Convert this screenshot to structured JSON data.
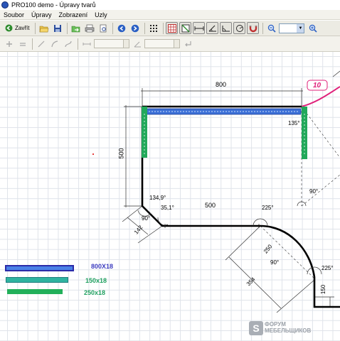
{
  "window": {
    "title": "PRO100 demo - Úpravy tvarů"
  },
  "menu": [
    "Soubor",
    "Úpravy",
    "Zobrazení",
    "Uzly"
  ],
  "toolbar": {
    "close_label": "Zavřít"
  },
  "drawing": {
    "dim_top": "800",
    "dim_left": "500",
    "dim_mid": "500",
    "dim_142": "142",
    "dim_250": "250",
    "dim_354": "354",
    "dim_150": "150",
    "angle_135": "135°",
    "angle_134_9": "134,9°",
    "angle_35_1": "35,1°",
    "angle_90_a": "90°",
    "angle_90_b": "90°",
    "angle_90_c": "90°",
    "angle_225_a": "225°",
    "angle_225_b": "225°",
    "tag_10": "10"
  },
  "legend": [
    {
      "label": "800X18",
      "color": "#3c3cbf"
    },
    {
      "label": "150x18",
      "color": "#20a060"
    },
    {
      "label": "250x18",
      "color": "#20a060"
    }
  ],
  "watermark": {
    "line1": "ФОРУМ",
    "line2": "МЕБЕЛЬЩИКОВ"
  }
}
